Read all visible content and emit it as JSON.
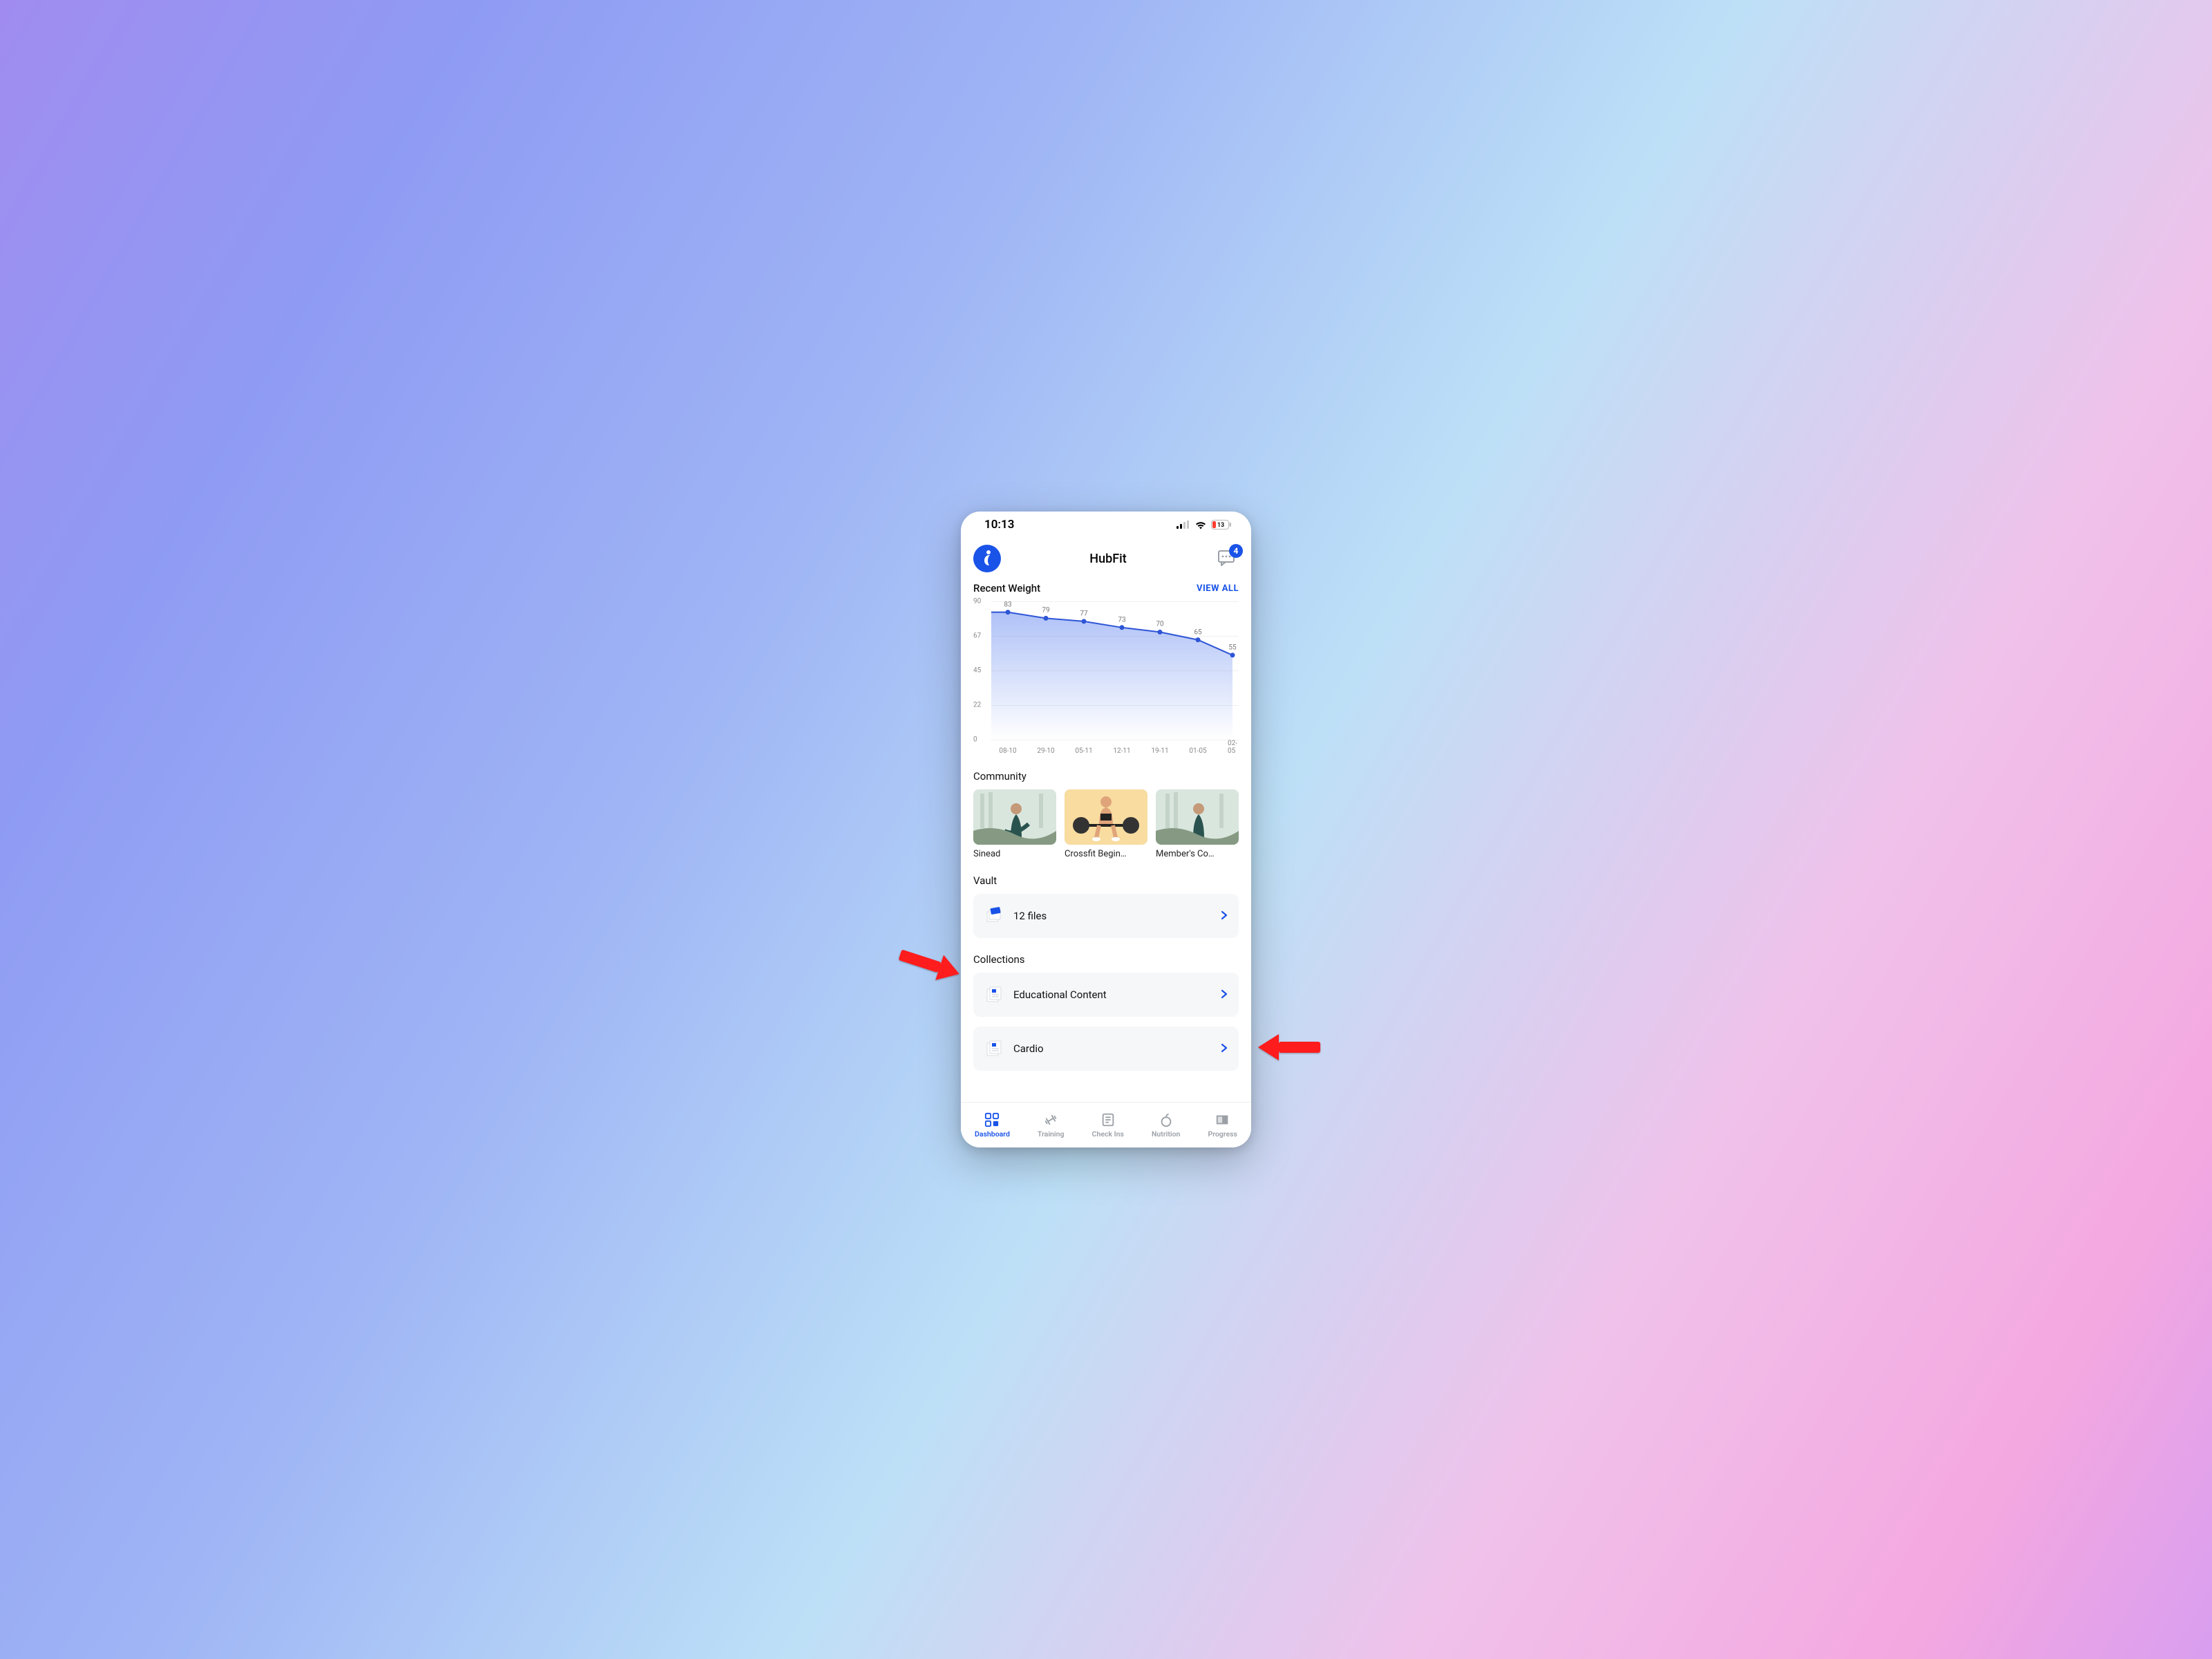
{
  "status": {
    "time": "10:13",
    "battery": "13"
  },
  "header": {
    "title": "HubFit",
    "badge": "4"
  },
  "chart": {
    "title": "Recent Weight",
    "view_all": "VIEW ALL"
  },
  "chart_data": {
    "type": "line",
    "title": "Recent Weight",
    "ylabel": "",
    "xlabel": "",
    "ylim": [
      0,
      90
    ],
    "y_ticks": [
      90,
      67,
      45,
      22,
      0
    ],
    "categories": [
      "08-10",
      "29-10",
      "05-11",
      "12-11",
      "19-11",
      "01-05",
      "02-05"
    ],
    "values": [
      83,
      79,
      77,
      73,
      70,
      65,
      55
    ]
  },
  "community": {
    "title": "Community",
    "items": [
      {
        "label": "Sinead"
      },
      {
        "label": "Crossfit Begin…"
      },
      {
        "label": "Member's Co…"
      }
    ]
  },
  "vault": {
    "title": "Vault",
    "row_label": "12 files"
  },
  "collections": {
    "title": "Collections",
    "items": [
      {
        "label": "Educational Content"
      },
      {
        "label": "Cardio"
      }
    ]
  },
  "tabs": {
    "dashboard": "Dashboard",
    "training": "Training",
    "checkins": "Check Ins",
    "nutrition": "Nutrition",
    "progress": "Progress"
  }
}
